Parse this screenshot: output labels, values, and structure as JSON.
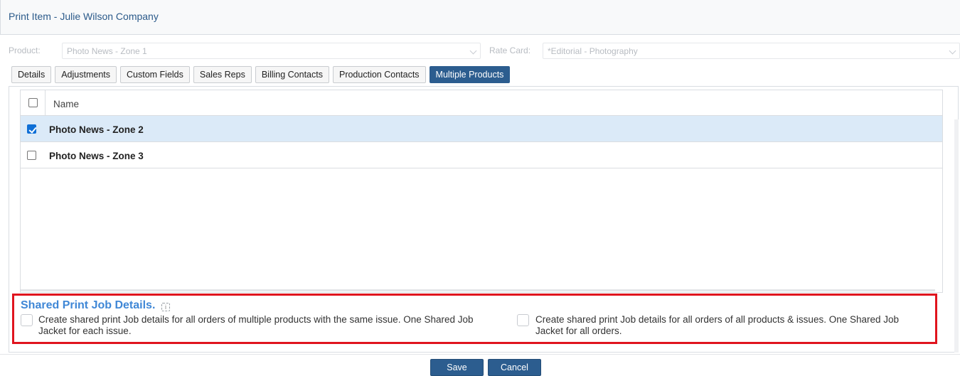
{
  "window": {
    "title": "Print Item - Julie Wilson Company"
  },
  "form": {
    "product_label": "Product:",
    "product_value": "Photo News - Zone 1",
    "rate_card_label": "Rate Card:",
    "rate_card_value": "*Editorial - Photography"
  },
  "tabs": [
    {
      "label": "Details"
    },
    {
      "label": "Adjustments"
    },
    {
      "label": "Custom Fields"
    },
    {
      "label": "Sales Reps"
    },
    {
      "label": "Billing Contacts"
    },
    {
      "label": "Production Contacts"
    },
    {
      "label": "Multiple Products",
      "active": true
    }
  ],
  "grid": {
    "header": {
      "name": "Name"
    },
    "rows": [
      {
        "name": "Photo News - Zone 2",
        "checked": true
      },
      {
        "name": "Photo News - Zone 3",
        "checked": false
      }
    ]
  },
  "shared": {
    "heading": "Shared Print Job Details.",
    "info_glyph": "i",
    "option1_line1": "Create shared print Job details for all orders of multiple products with the same issue. One Shared Job",
    "option1_line2": "Jacket for each issue.",
    "option2_line1": "Create shared print Job details for all orders of all products & issues. One Shared Job",
    "option2_line2": "Jacket for all orders."
  },
  "footer": {
    "save_label": "Save",
    "cancel_label": "Cancel"
  },
  "colors": {
    "accent": "#2c5d8f",
    "selected_row": "#dbeaf8",
    "highlight_border": "#e0141e",
    "heading": "#3f87d6"
  }
}
